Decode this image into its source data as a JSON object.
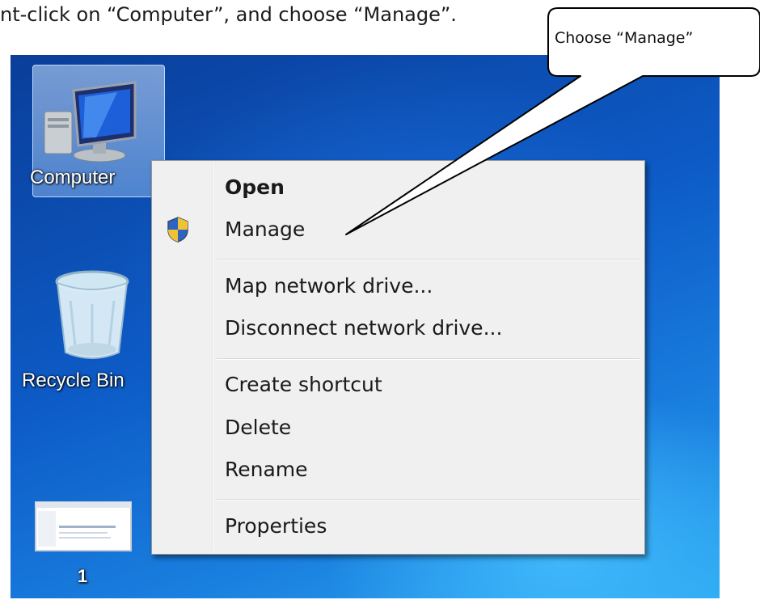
{
  "instruction": "nt-click on “Computer”, and choose “Manage”.",
  "callout": "Choose “Manage”",
  "desktop": {
    "icons": [
      {
        "label": "Computer"
      },
      {
        "label": "Recycle Bin"
      },
      {
        "label": "1"
      }
    ]
  },
  "context_menu": {
    "items": [
      {
        "label": "Open",
        "bold": true
      },
      {
        "label": "Manage",
        "icon": "uac-shield-icon"
      },
      {
        "label": "Map network drive..."
      },
      {
        "label": "Disconnect network drive..."
      },
      {
        "label": "Create shortcut"
      },
      {
        "label": "Delete"
      },
      {
        "label": "Rename"
      },
      {
        "label": "Properties"
      }
    ]
  },
  "colors": {
    "desktop_blue": "#0d5bc6",
    "menu_background": "#f0f0f0",
    "menu_border": "#979797"
  }
}
